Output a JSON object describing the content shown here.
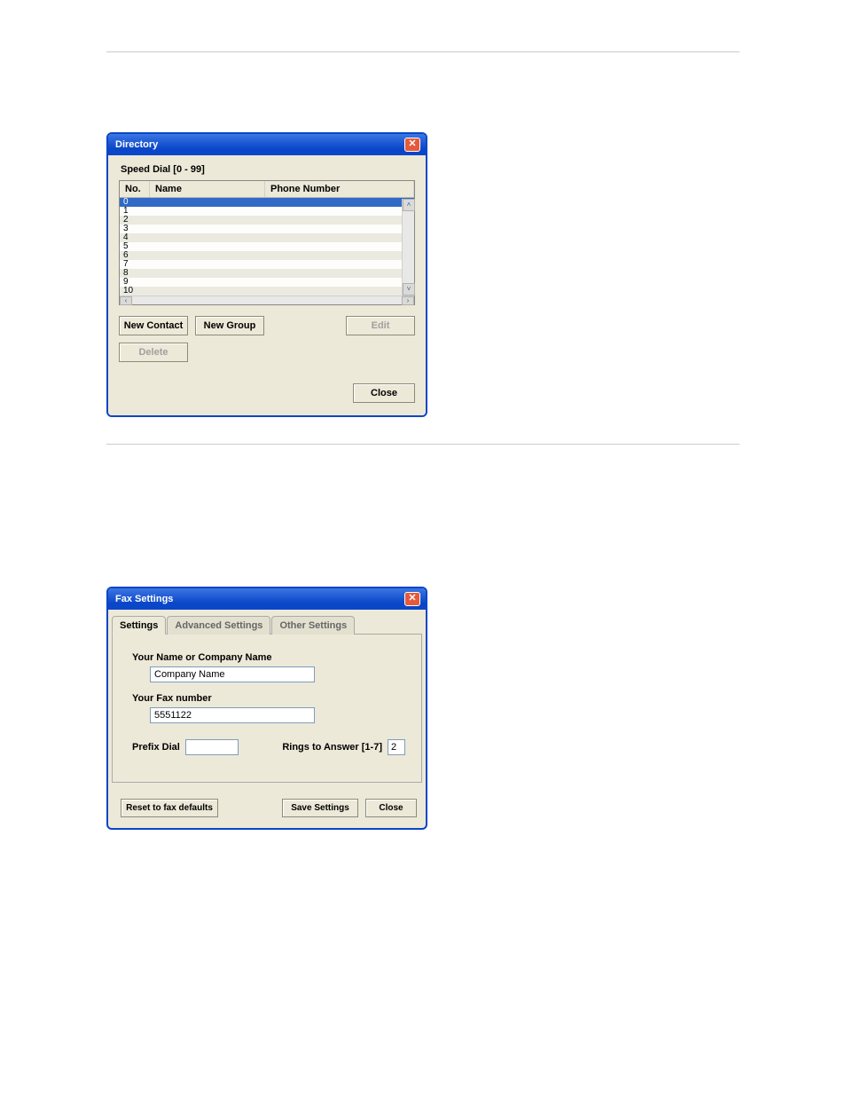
{
  "directory": {
    "title": "Directory",
    "panel_label": "Speed Dial [0 - 99]",
    "headers": {
      "no": "No.",
      "name": "Name",
      "phone": "Phone Number"
    },
    "rows": [
      {
        "no": "0",
        "name": "",
        "phone": ""
      },
      {
        "no": "1",
        "name": "",
        "phone": ""
      },
      {
        "no": "2",
        "name": "",
        "phone": ""
      },
      {
        "no": "3",
        "name": "",
        "phone": ""
      },
      {
        "no": "4",
        "name": "",
        "phone": ""
      },
      {
        "no": "5",
        "name": "",
        "phone": ""
      },
      {
        "no": "6",
        "name": "",
        "phone": ""
      },
      {
        "no": "7",
        "name": "",
        "phone": ""
      },
      {
        "no": "8",
        "name": "",
        "phone": ""
      },
      {
        "no": "9",
        "name": "",
        "phone": ""
      },
      {
        "no": "10",
        "name": "",
        "phone": ""
      }
    ],
    "buttons": {
      "new_contact": "New Contact",
      "new_group": "New Group",
      "edit": "Edit",
      "delete": "Delete",
      "close": "Close"
    }
  },
  "fax": {
    "title": "Fax Settings",
    "tabs": {
      "settings": "Settings",
      "advanced": "Advanced Settings",
      "other": "Other Settings"
    },
    "fields": {
      "name_label": "Your Name or Company Name",
      "name_value": "Company Name",
      "faxnum_label": "Your Fax number",
      "faxnum_value": "5551122",
      "prefix_label": "Prefix Dial",
      "prefix_value": "",
      "rings_label": "Rings to Answer [1-7]",
      "rings_value": "2"
    },
    "buttons": {
      "reset": "Reset to fax defaults",
      "save": "Save Settings",
      "close": "Close"
    }
  },
  "icons": {
    "close_x": "✕",
    "up": "˄",
    "down": "˅",
    "left": "‹",
    "right": "›"
  }
}
